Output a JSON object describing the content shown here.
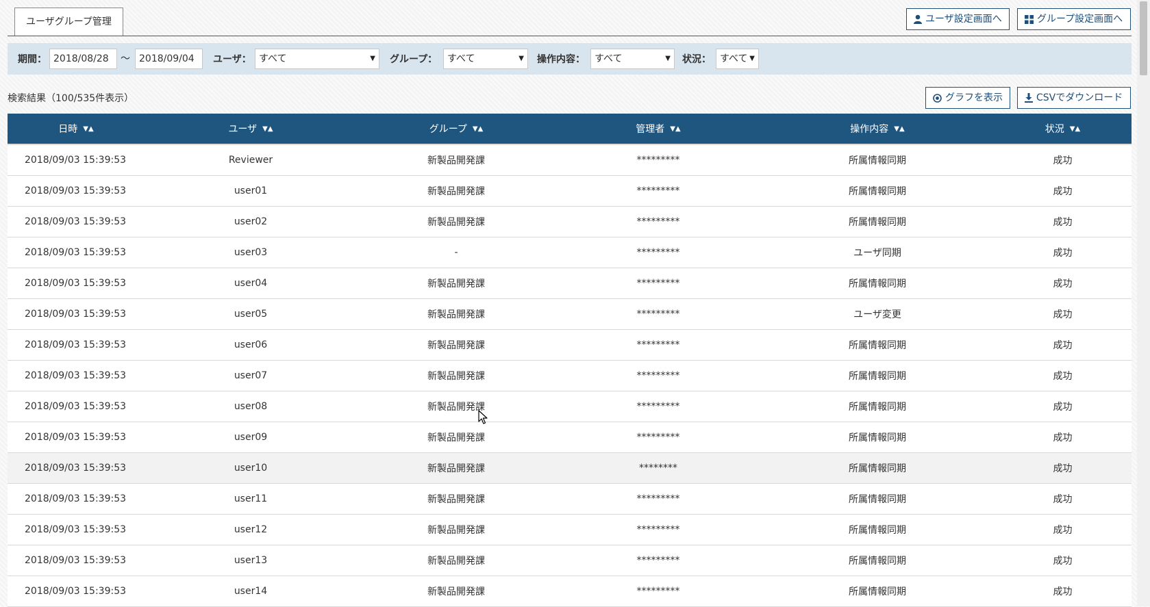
{
  "header": {
    "tab_title": "ユーザグループ管理",
    "user_settings_button": "ユーザ設定画面へ",
    "group_settings_button": "グループ設定画面へ",
    "user_icon": "user-icon",
    "grid_icon": "grid-icon"
  },
  "filters": {
    "period_label": "期間：",
    "date_from": "2018/08/28",
    "tilde": "～",
    "date_to": "2018/09/04",
    "user_label": "ユーザ：",
    "user_value": "すべて",
    "group_label": "グループ：",
    "group_value": "すべて",
    "operation_label": "操作内容：",
    "operation_value": "すべて",
    "status_label": "状況：",
    "status_value": "すべて"
  },
  "results": {
    "count_text": "検索結果（100/535件表示）",
    "graph_button": "グラフを表示",
    "csv_button": "CSVでダウンロード"
  },
  "table": {
    "columns": [
      "日時",
      "ユーザ",
      "グループ",
      "管理者",
      "操作内容",
      "状況"
    ],
    "rows": [
      [
        "2018/09/03 15:39:53",
        "Reviewer",
        "新製品開発課",
        "*********",
        "所属情報同期",
        "成功"
      ],
      [
        "2018/09/03 15:39:53",
        "user01",
        "新製品開発課",
        "*********",
        "所属情報同期",
        "成功"
      ],
      [
        "2018/09/03 15:39:53",
        "user02",
        "新製品開発課",
        "*********",
        "所属情報同期",
        "成功"
      ],
      [
        "2018/09/03 15:39:53",
        "user03",
        "-",
        "*********",
        "ユーザ同期",
        "成功"
      ],
      [
        "2018/09/03 15:39:53",
        "user04",
        "新製品開発課",
        "*********",
        "所属情報同期",
        "成功"
      ],
      [
        "2018/09/03 15:39:53",
        "user05",
        "新製品開発課",
        "*********",
        "ユーザ変更",
        "成功"
      ],
      [
        "2018/09/03 15:39:53",
        "user06",
        "新製品開発課",
        "*********",
        "所属情報同期",
        "成功"
      ],
      [
        "2018/09/03 15:39:53",
        "user07",
        "新製品開発課",
        "*********",
        "所属情報同期",
        "成功"
      ],
      [
        "2018/09/03 15:39:53",
        "user08",
        "新製品開発課",
        "*********",
        "所属情報同期",
        "成功"
      ],
      [
        "2018/09/03 15:39:53",
        "user09",
        "新製品開発課",
        "*********",
        "所属情報同期",
        "成功"
      ],
      [
        "2018/09/03 15:39:53",
        "user10",
        "新製品開発課",
        "********",
        "所属情報同期",
        "成功"
      ],
      [
        "2018/09/03 15:39:53",
        "user11",
        "新製品開発課",
        "*********",
        "所属情報同期",
        "成功"
      ],
      [
        "2018/09/03 15:39:53",
        "user12",
        "新製品開発課",
        "*********",
        "所属情報同期",
        "成功"
      ],
      [
        "2018/09/03 15:39:53",
        "user13",
        "新製品開発課",
        "*********",
        "所属情報同期",
        "成功"
      ],
      [
        "2018/09/03 15:39:53",
        "user14",
        "新製品開発課",
        "*********",
        "所属情報同期",
        "成功"
      ]
    ]
  }
}
